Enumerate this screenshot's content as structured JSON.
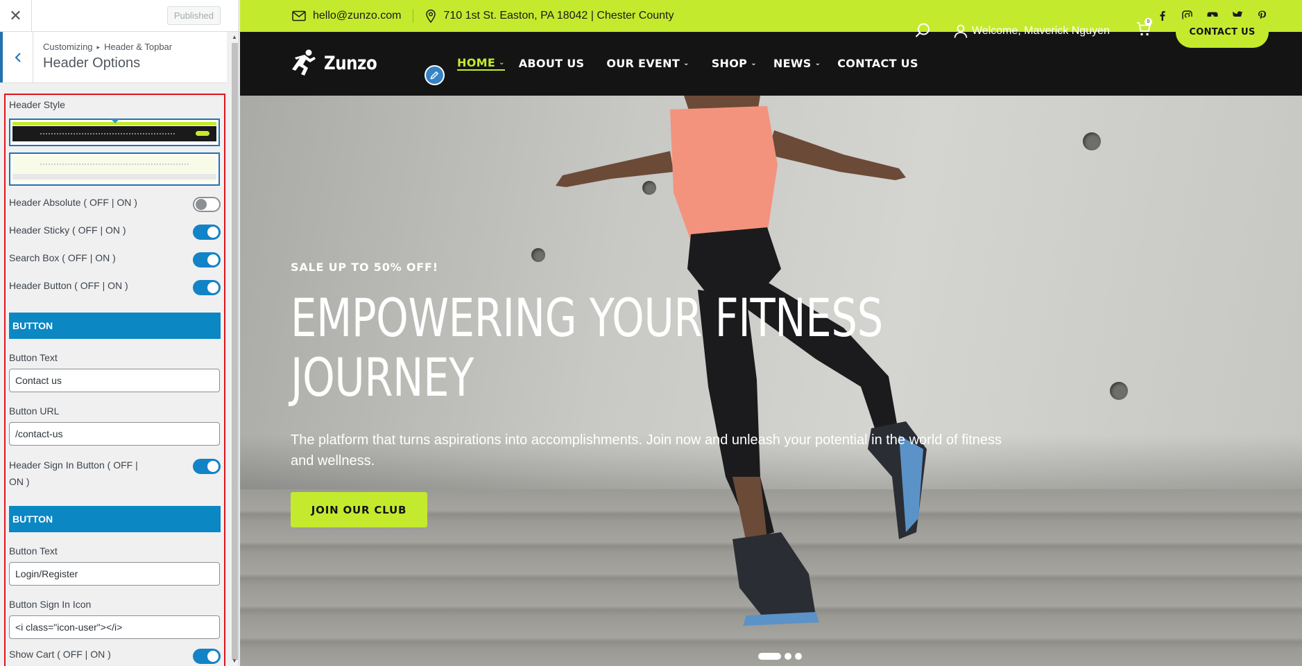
{
  "customizer": {
    "close_glyph": "✕",
    "published_label": "Published",
    "breadcrumb_root": "Customizing",
    "breadcrumb_sep": "▸",
    "breadcrumb_section": "Header & Topbar",
    "section_title": "Header Options",
    "header_style_label": "Header Style",
    "toggles_top": [
      {
        "label": "Header Absolute ( OFF | ON )",
        "on": false
      },
      {
        "label": "Header Sticky ( OFF | ON )",
        "on": true
      },
      {
        "label": "Search Box ( OFF | ON )",
        "on": true
      },
      {
        "label": "Header Button ( OFF | ON )",
        "on": true
      }
    ],
    "button_group": {
      "heading": "BUTTON",
      "text_label": "Button Text",
      "text_value": "Contact us",
      "url_label": "Button URL",
      "url_value": "/contact-us"
    },
    "signin_toggle": {
      "label": "Header Sign In Button ( OFF | ON )",
      "on": true
    },
    "signin_group": {
      "heading": "BUTTON",
      "text_label": "Button Text",
      "text_value": "Login/Register",
      "icon_label": "Button Sign In Icon",
      "icon_value": "<i class=\"icon-user\"></i>"
    },
    "cart_toggle": {
      "label": "Show Cart ( OFF | ON )",
      "on": true
    }
  },
  "site": {
    "email": "hello@zunzo.com",
    "address": "710 1st St. Easton, PA 18042 | Chester County",
    "social_icons": [
      "facebook-icon",
      "instagram-icon",
      "youtube-icon",
      "twitter-icon",
      "pinterest-icon"
    ],
    "logo_text": "Zunzo",
    "menu": [
      {
        "label": "HOME",
        "dropdown": true,
        "active": true
      },
      {
        "label": "ABOUT US",
        "dropdown": false,
        "active": false
      },
      {
        "label": "OUR EVENT",
        "dropdown": true,
        "active": false
      },
      {
        "label": "SHOP",
        "dropdown": true,
        "active": false
      },
      {
        "label": "NEWS",
        "dropdown": true,
        "active": false
      },
      {
        "label": "CONTACT US",
        "dropdown": false,
        "active": false
      }
    ],
    "welcome": "Welcome, Maverick Nguyen",
    "cart_count": "0",
    "nav_cta": "CONTACT US",
    "hero": {
      "kicker": "SALE UP TO 50% OFF!",
      "title_line1": "EMPOWERING YOUR FITNESS",
      "title_line2": "JOURNEY",
      "subtitle": "The platform that turns aspirations into accomplishments. Join now and unleash your potential in the world of fitness and wellness.",
      "button": "JOIN OUR CLUB",
      "slides": 3,
      "active_slide": 1
    },
    "colors": {
      "accent": "#c4ea2e",
      "dark": "#141414",
      "wp_blue": "#0b87c4",
      "highlight_border": "#e0121b"
    }
  }
}
